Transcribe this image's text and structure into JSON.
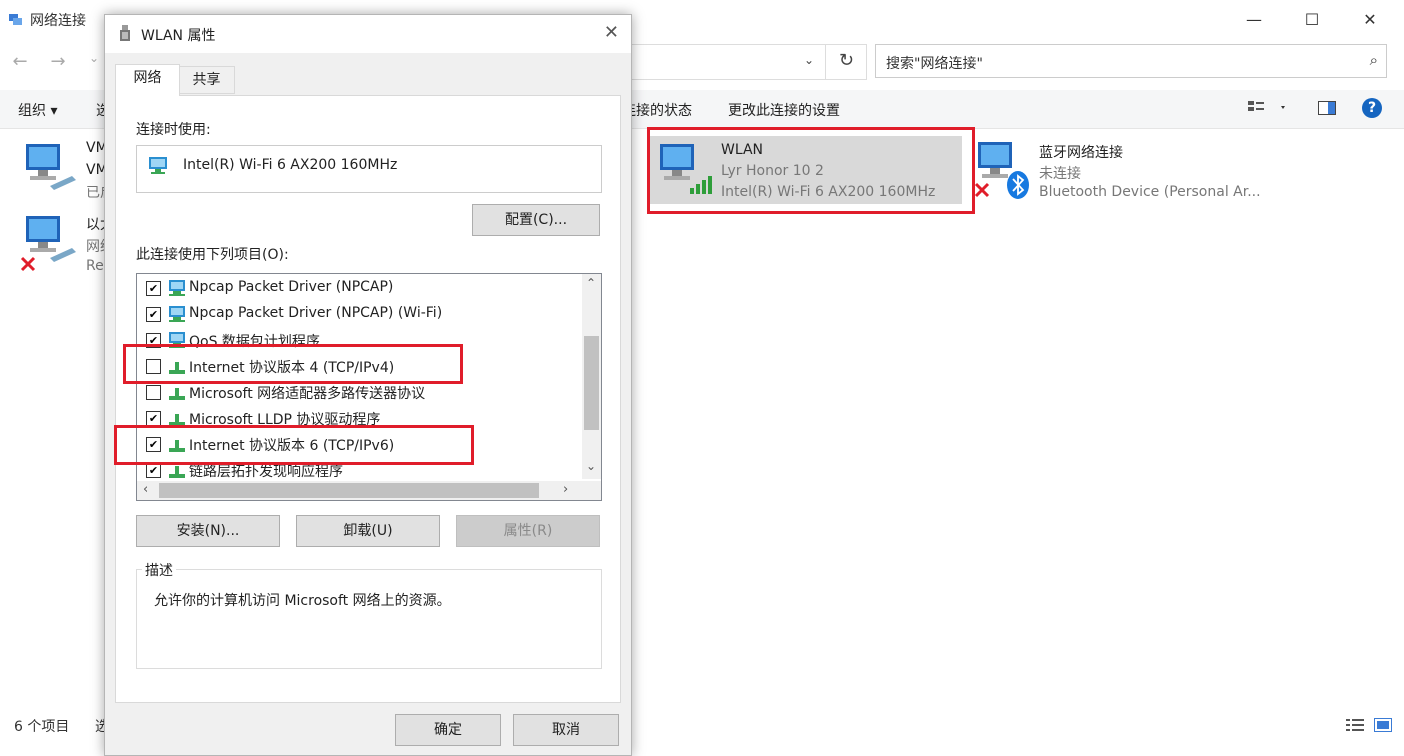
{
  "background_window": {
    "title": "网络连接",
    "controls": {
      "minimize": "—",
      "maximize": "☐",
      "close": "✕"
    },
    "nav": {
      "back": "←",
      "forward": "→",
      "recent": "⌄"
    },
    "address": {
      "dropdown": "⌄",
      "refresh": "↻"
    },
    "search_placeholder": "搜索\"网络连接\"",
    "search_icon": "⌕",
    "command_bar": {
      "organize": "组织 ▾",
      "partial_item": "选",
      "view_status": "连接的状态",
      "change_settings": "更改此连接的设置",
      "help": "?"
    },
    "connections": [
      {
        "name": "VM",
        "line2": "VM",
        "line3": "已启"
      },
      {
        "name": "以太",
        "line2": "网络",
        "line3": "Re"
      },
      {
        "name": "WLAN",
        "line2": "Lyr Honor 10 2",
        "line3": "Intel(R) Wi-Fi 6 AX200 160MHz"
      },
      {
        "name": "蓝牙网络连接",
        "line2": "未连接",
        "line3": "Bluetooth Device (Personal Ar..."
      }
    ],
    "status": {
      "item_count": "6 个项目",
      "partial": "选"
    }
  },
  "dialog": {
    "title": "WLAN 属性",
    "close": "✕",
    "tabs": [
      "网络",
      "共享"
    ],
    "connect_using_label": "连接时使用:",
    "adapter_name": "Intel(R) Wi-Fi 6 AX200 160MHz",
    "configure_button": "配置(C)...",
    "items_label": "此连接使用下列项目(O):",
    "items": [
      {
        "label": "Npcap Packet Driver (NPCAP)",
        "checked": true
      },
      {
        "label": "Npcap Packet Driver (NPCAP) (Wi-Fi)",
        "checked": true
      },
      {
        "label": "QoS 数据包计划程序",
        "checked": true
      },
      {
        "label": "Internet 协议版本 4 (TCP/IPv4)",
        "checked": false
      },
      {
        "label": "Microsoft 网络适配器多路传送器协议",
        "checked": false
      },
      {
        "label": "Microsoft LLDP 协议驱动程序",
        "checked": true
      },
      {
        "label": "Internet 协议版本 6 (TCP/IPv6)",
        "checked": true
      },
      {
        "label": "链路层拓扑发现响应程序",
        "checked": true
      }
    ],
    "install_button": "安装(N)...",
    "uninstall_button": "卸载(U)",
    "properties_button": "属性(R)",
    "description_title": "描述",
    "description_text": "允许你的计算机访问 Microsoft 网络上的资源。",
    "ok_button": "确定",
    "cancel_button": "取消"
  },
  "colors": {
    "highlight": "#e01d2a",
    "accent": "#0078d7"
  }
}
